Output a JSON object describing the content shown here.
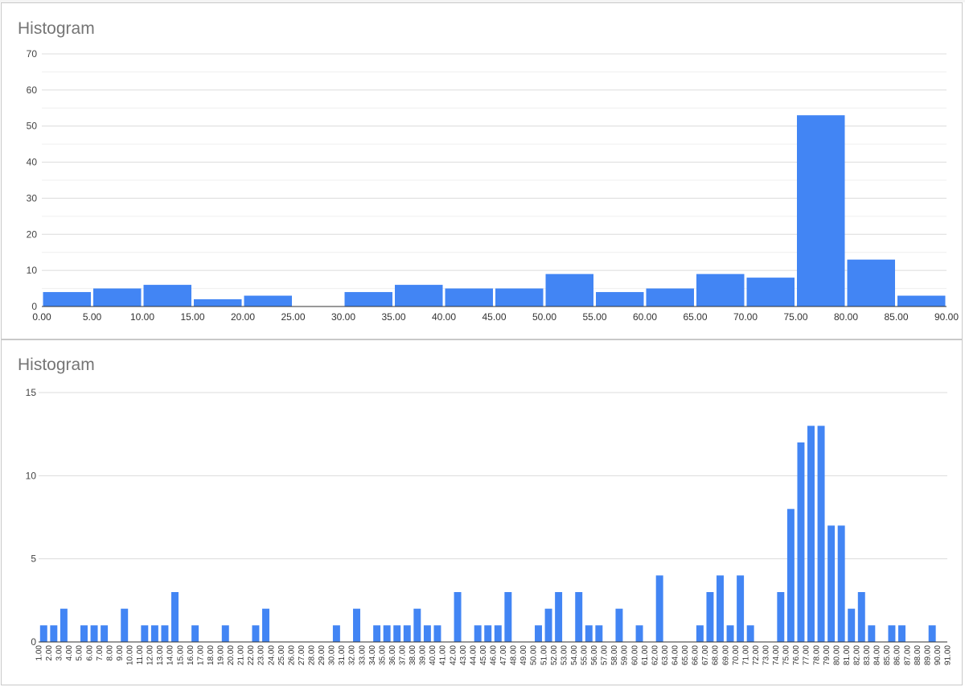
{
  "chart_data": [
    {
      "type": "bar",
      "title": "Histogram",
      "xlabel": "",
      "ylabel": "",
      "ylim": [
        0,
        70
      ],
      "yticks": [
        "0",
        "10",
        "20",
        "30",
        "40",
        "50",
        "60",
        "70"
      ],
      "xticks": [
        "0.00",
        "5.00",
        "10.00",
        "15.00",
        "20.00",
        "25.00",
        "30.00",
        "35.00",
        "40.00",
        "45.00",
        "50.00",
        "55.00",
        "60.00",
        "65.00",
        "70.00",
        "75.00",
        "80.00",
        "85.00",
        "90.00"
      ],
      "bin_width": 5,
      "bins_start": [
        0,
        5,
        10,
        15,
        20,
        25,
        30,
        35,
        40,
        45,
        50,
        55,
        60,
        65,
        70,
        75,
        80,
        85
      ],
      "values": [
        4,
        5,
        6,
        2,
        3,
        0,
        4,
        6,
        5,
        5,
        9,
        4,
        5,
        9,
        8,
        53,
        13,
        3
      ],
      "grid": true,
      "legend": "none",
      "bar_color": "#4285f4"
    },
    {
      "type": "bar",
      "title": "Histogram",
      "xlabel": "",
      "ylabel": "",
      "ylim": [
        0,
        15
      ],
      "yticks": [
        "0",
        "5",
        "10",
        "15"
      ],
      "xticks": [
        "1.00",
        "2.00",
        "3.00",
        "4.00",
        "5.00",
        "6.00",
        "7.00",
        "8.00",
        "9.00",
        "10.00",
        "11.00",
        "12.00",
        "13.00",
        "14.00",
        "15.00",
        "16.00",
        "17.00",
        "18.00",
        "19.00",
        "20.00",
        "21.00",
        "22.00",
        "23.00",
        "24.00",
        "25.00",
        "26.00",
        "27.00",
        "28.00",
        "29.00",
        "30.00",
        "31.00",
        "32.00",
        "33.00",
        "34.00",
        "35.00",
        "36.00",
        "37.00",
        "38.00",
        "39.00",
        "40.00",
        "41.00",
        "42.00",
        "43.00",
        "44.00",
        "45.00",
        "46.00",
        "47.00",
        "48.00",
        "49.00",
        "50.00",
        "51.00",
        "52.00",
        "53.00",
        "54.00",
        "55.00",
        "56.00",
        "57.00",
        "58.00",
        "59.00",
        "60.00",
        "61.00",
        "62.00",
        "63.00",
        "64.00",
        "65.00",
        "66.00",
        "67.00",
        "68.00",
        "69.00",
        "70.00",
        "71.00",
        "72.00",
        "73.00",
        "74.00",
        "75.00",
        "76.00",
        "77.00",
        "78.00",
        "79.00",
        "80.00",
        "81.00",
        "82.00",
        "83.00",
        "84.00",
        "85.00",
        "86.00",
        "87.00",
        "88.00",
        "89.00",
        "90.00",
        "91.00"
      ],
      "bin_width": 1,
      "values": [
        1,
        1,
        2,
        0,
        1,
        1,
        1,
        0,
        2,
        0,
        1,
        1,
        1,
        3,
        0,
        1,
        0,
        0,
        1,
        0,
        0,
        1,
        2,
        0,
        0,
        0,
        0,
        0,
        0,
        1,
        0,
        2,
        0,
        1,
        1,
        1,
        1,
        2,
        1,
        1,
        0,
        3,
        0,
        1,
        1,
        1,
        3,
        0,
        0,
        1,
        2,
        3,
        0,
        3,
        1,
        1,
        0,
        2,
        0,
        1,
        0,
        4,
        0,
        0,
        0,
        1,
        3,
        4,
        1,
        4,
        1,
        0,
        0,
        3,
        8,
        12,
        13,
        13,
        7,
        7,
        2,
        3,
        1,
        0,
        1,
        1,
        0,
        0,
        1,
        0
      ],
      "grid": true,
      "legend": "none",
      "bar_color": "#4285f4"
    }
  ]
}
